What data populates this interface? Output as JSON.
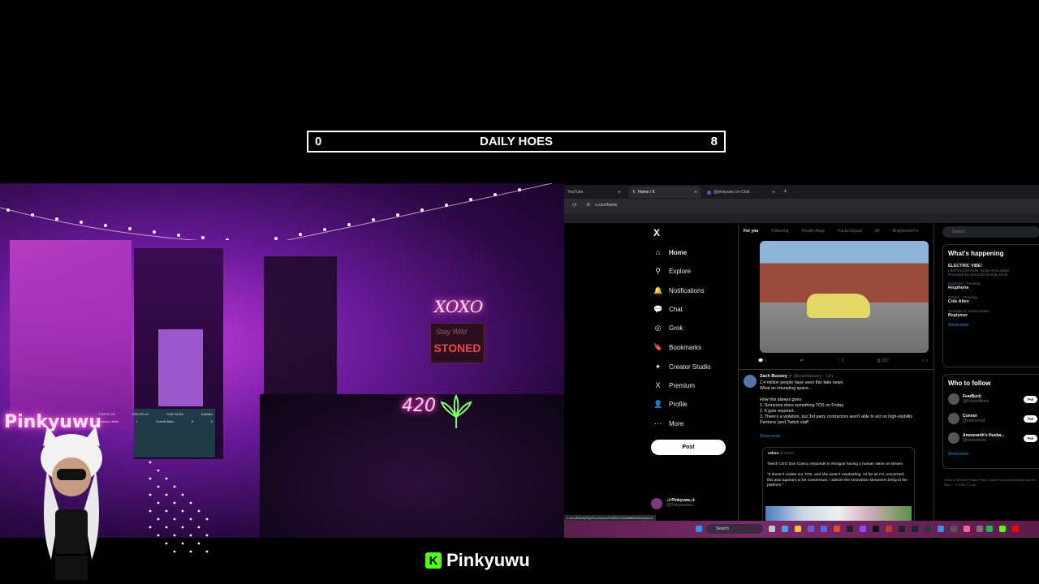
{
  "counter": {
    "left": "0",
    "title": "DAILY HOES",
    "right": "8"
  },
  "cam": {
    "neon_xoxo": "XOXO",
    "stoned_small": "Stay Wild",
    "stoned": "STONED",
    "neon_420": "420",
    "pinky_neon": "Pinkyuwu",
    "scoreboard": {
      "headers": [
        "KINGS ON",
        "FREEPLAY",
        "SUB MODE",
        "DAMBA"
      ],
      "row1": [
        "Session Balls",
        "1",
        "Overall Balls",
        "8",
        "0"
      ]
    }
  },
  "brand": {
    "logo_letter": "K",
    "name": "Pinkyuwu"
  },
  "browser": {
    "tabs": [
      {
        "label": "YouTube"
      },
      {
        "label": "Home / X"
      },
      {
        "label": "@pinkyuwu on Club"
      }
    ],
    "url": "x.com/home",
    "status_url": "x.com/RandyPopPec/status/2049487146988880430/photo/1"
  },
  "x": {
    "logo": "X",
    "nav": [
      {
        "icon": "⌂",
        "label": "Home"
      },
      {
        "icon": "⚲",
        "label": "Explore"
      },
      {
        "icon": "🔔",
        "label": "Notifications"
      },
      {
        "icon": "💬",
        "label": "Chat"
      },
      {
        "icon": "◎",
        "label": "Grok"
      },
      {
        "icon": "🔖",
        "label": "Bookmarks"
      },
      {
        "icon": "✦",
        "label": "Creator Studio"
      },
      {
        "icon": "X",
        "label": "Premium"
      },
      {
        "icon": "👤",
        "label": "Profile"
      },
      {
        "icon": "⋯",
        "label": "More"
      }
    ],
    "post_button": "Post",
    "account_name": "✨Pinkyuwu✨",
    "account_handle": "@Pinkyuwuuu",
    "feed_tabs": [
      "For you",
      "Following",
      "People Away",
      "Fucks-Squad",
      "Alt",
      "Brightened Fo"
    ],
    "media_actions": [
      "1",
      "",
      "3",
      "287",
      ""
    ],
    "tweet": {
      "name": "Zach Bussey",
      "handle": "@zachbussey · 11h",
      "body": "2.4 million people have seen this fake news.\nWhat an infuriating space...\n\nHow this always goes:\n1. Someone does something TOS on Friday.\n2. It gets reported.\n3. There's a violation, but 3rd party contractors aren't able to act on high-visibility Partners (and Twitch staff",
      "show_more": "Show more"
    },
    "quote": {
      "name": "velzzo",
      "handle": "@Velzzo",
      "text": "Twitch CEO Dan Clancy responds to Morgpie having a human slave on stream\n\n\"It doesn't violate our TOS, and she wasn't viewbotting. As far as I'm concerned, this also appears to be consensual. I admire the innovation streamers bring to the platform.\""
    },
    "search_placeholder": "Search",
    "whats_happening": {
      "title": "What's happening",
      "items": [
        {
          "meta": "LIMITED EDITION. NOW AVAILABLE.",
          "title": "ELECTRIC VIBE!",
          "sub": "Promoted by CELSIUS Energy Drink"
        },
        {
          "meta": "Euphoria · Trending",
          "title": "#euphoria"
        },
        {
          "meta": "Politics · Trending",
          "title": "Cole Allen"
        },
        {
          "meta": "Trending in United States",
          "title": "Replymer"
        }
      ],
      "show_more": "Show more"
    },
    "who_to_follow": {
      "title": "Who to follow",
      "items": [
        {
          "name": "FearBuck",
          "handle": "@FearedBuck",
          "button": "Fol"
        },
        {
          "name": "Connor",
          "handle": "@connorcrd",
          "button": "Fol"
        },
        {
          "name": "Amouranth's Husba...",
          "handle": "@nickwickee",
          "button": "Fol"
        }
      ],
      "show_more": "Show more"
    },
    "footer": "Terms of Service  Privacy Policy  Cookie Policy  Accessibility  Ads info  More ...  © 2026 X Corp."
  },
  "taskbar": {
    "search": "Search"
  }
}
